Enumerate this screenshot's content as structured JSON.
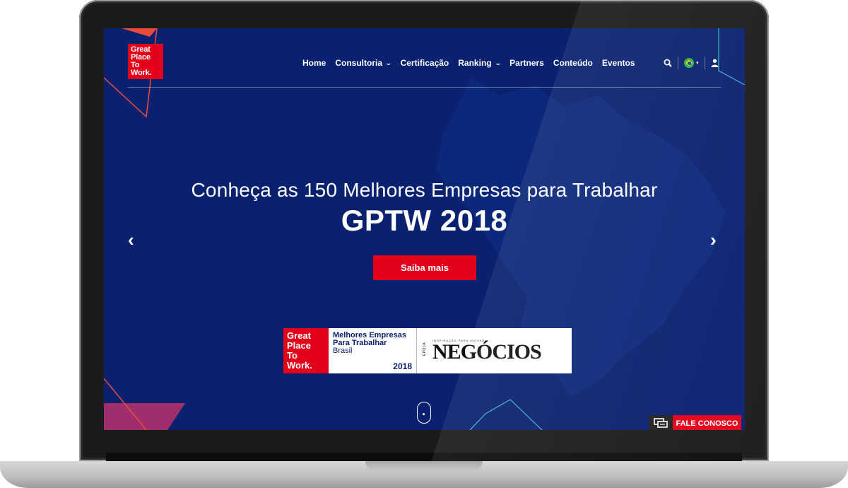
{
  "logo": {
    "lines": [
      "Great",
      "Place",
      "To",
      "Work."
    ]
  },
  "nav": {
    "items": [
      {
        "label": "Home"
      },
      {
        "label": "Consultoria"
      },
      {
        "label": "Certificação"
      },
      {
        "label": "Ranking"
      },
      {
        "label": "Partners"
      },
      {
        "label": "Conteúdo"
      },
      {
        "label": "Eventos"
      }
    ],
    "search_icon": "search-icon",
    "language_icon": "brazil-flag-icon",
    "user_icon": "user-icon"
  },
  "hero": {
    "subtitle": "Conheça as 150 Melhores Empresas para Trabalhar",
    "title": "GPTW 2018",
    "cta_label": "Saiba mais",
    "prev_arrow": "‹",
    "next_arrow": "›"
  },
  "banner": {
    "logo_lines": [
      "Great",
      "Place",
      "To",
      "Work."
    ],
    "line1": "Melhores Empresas",
    "line2": "Para Trabalhar",
    "line3": "Brasil",
    "year": "2018",
    "magazine_tag": "INSPIRAÇÃO PARA INOVAR",
    "magazine_prefix": "ÉPOCA",
    "magazine_name": "NEGÓCIOS"
  },
  "chat": {
    "label": "FALE CONOSCO"
  },
  "colors": {
    "background": "#0a2170",
    "accent": "#e3001b"
  }
}
